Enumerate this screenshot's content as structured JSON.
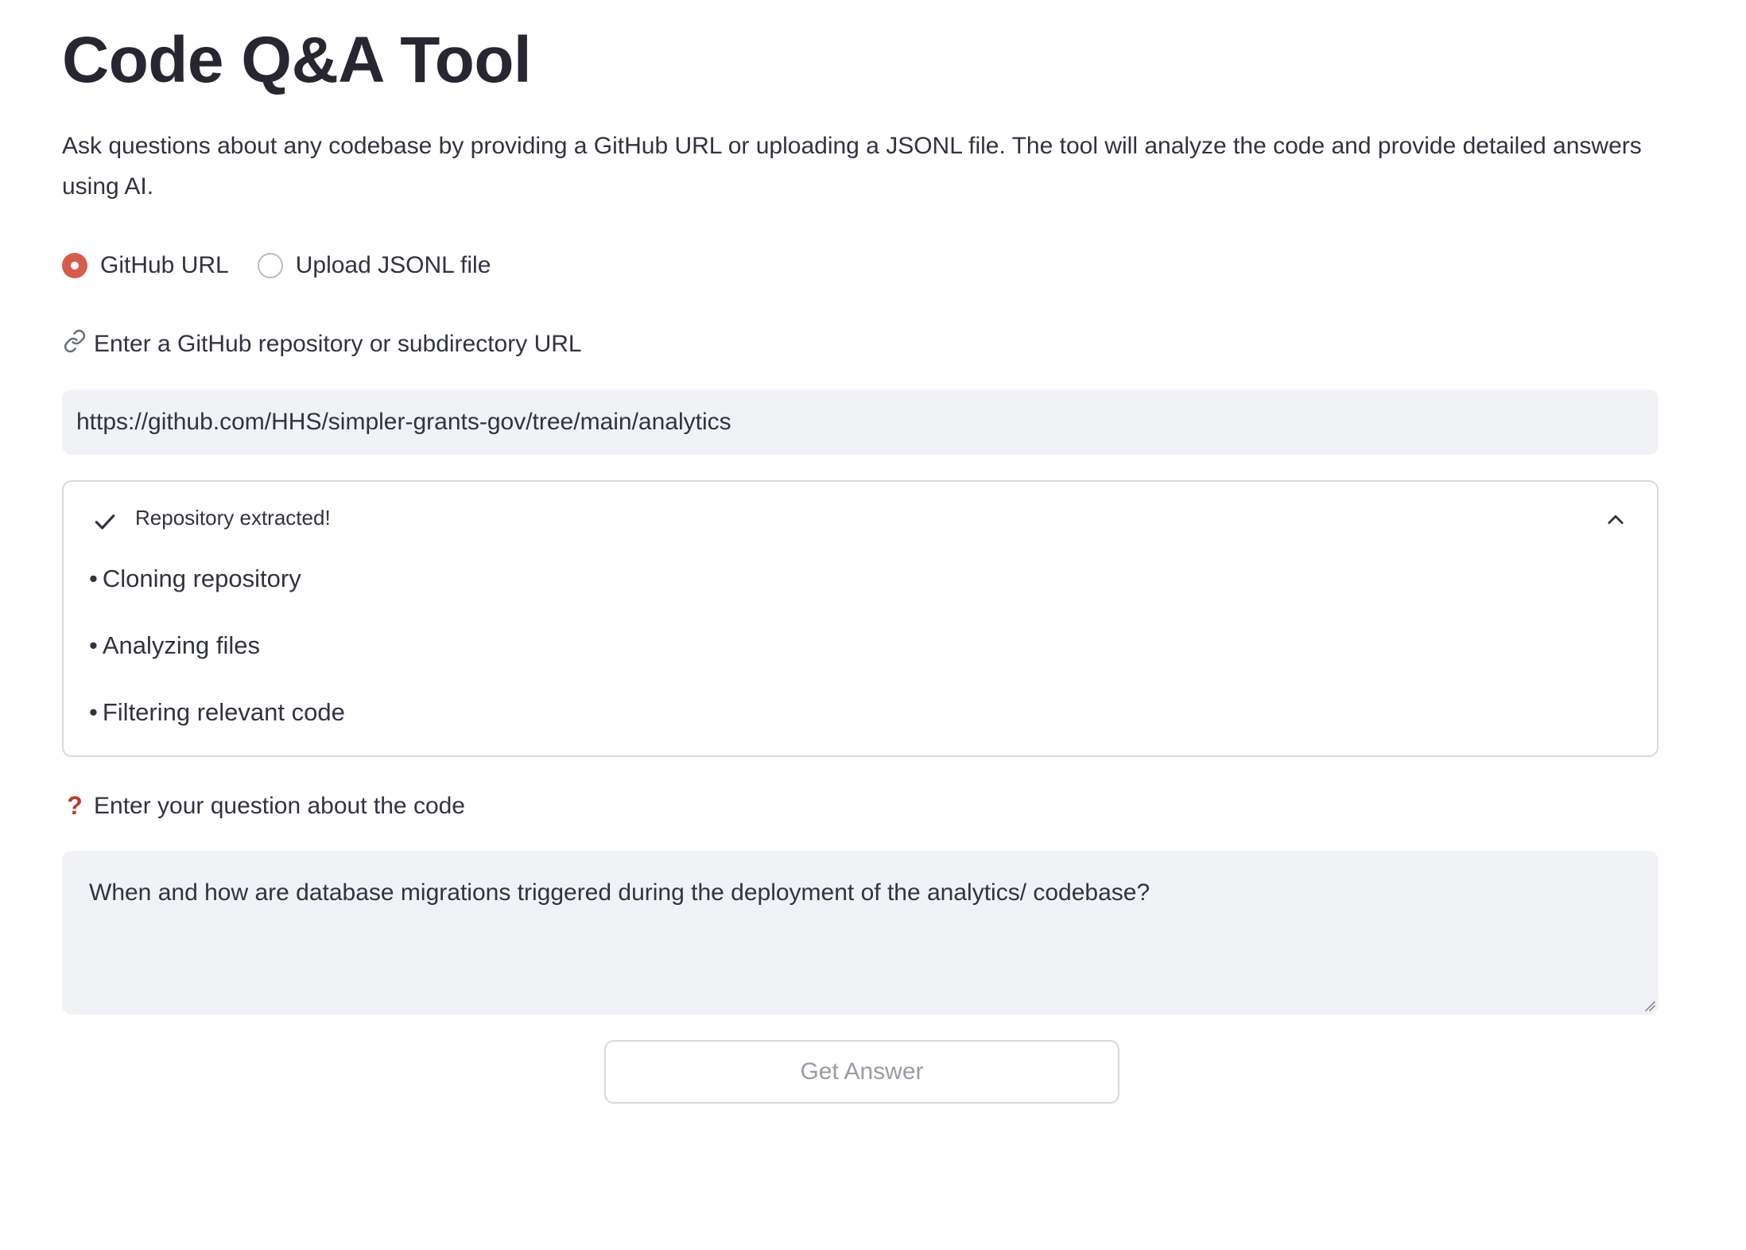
{
  "header": {
    "title": "Code Q&A Tool",
    "description": "Ask questions about any codebase by providing a GitHub URL or uploading a JSONL file. The tool will analyze the code and provide detailed answers using AI."
  },
  "source_options": {
    "options": [
      {
        "label": "GitHub URL",
        "selected": true
      },
      {
        "label": "Upload JSONL file",
        "selected": false
      }
    ]
  },
  "url_field": {
    "icon": "link-icon",
    "label": "Enter a GitHub repository or subdirectory URL",
    "value": "https://github.com/HHS/simpler-grants-gov/tree/main/analytics"
  },
  "status": {
    "icon": "check-icon",
    "title": "Repository extracted!",
    "expanded": true,
    "steps": [
      "Cloning repository",
      "Analyzing files",
      "Filtering relevant code"
    ]
  },
  "question_field": {
    "icon": "question-icon",
    "icon_glyph": "?",
    "label": "Enter your question about the code",
    "value": "When and how are database migrations triggered during the deployment of the analytics/ codebase?"
  },
  "actions": {
    "get_answer_label": "Get Answer"
  },
  "colors": {
    "accent": "#d65c4e",
    "input_bg": "#f0f2f6",
    "text": "#31333f",
    "disabled_text": "#9a9ca4"
  }
}
